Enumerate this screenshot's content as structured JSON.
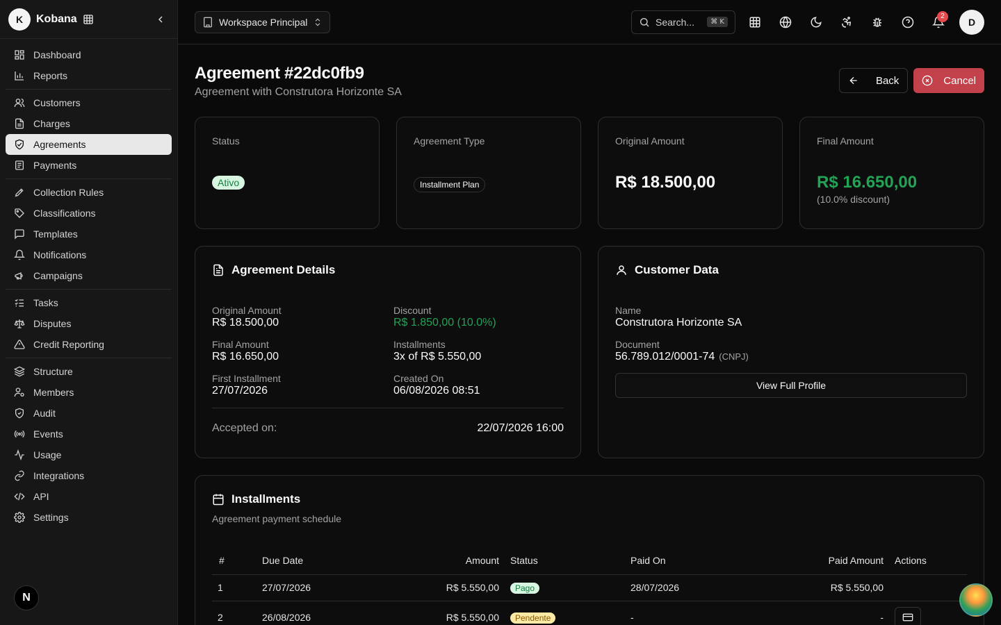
{
  "brand": {
    "initial": "K",
    "name": "Kobana"
  },
  "sidebar": {
    "groups": [
      [
        {
          "label": "Dashboard",
          "icon": "dashboard-icon"
        },
        {
          "label": "Reports",
          "icon": "chart-bar-icon"
        }
      ],
      [
        {
          "label": "Customers",
          "icon": "users-icon"
        },
        {
          "label": "Charges",
          "icon": "receipt-icon"
        },
        {
          "label": "Agreements",
          "icon": "handshake-icon",
          "active": true
        },
        {
          "label": "Payments",
          "icon": "wallet-icon"
        }
      ],
      [
        {
          "label": "Collection Rules",
          "icon": "pencil-ruler-icon"
        },
        {
          "label": "Classifications",
          "icon": "tags-icon"
        },
        {
          "label": "Templates",
          "icon": "message-square-icon"
        },
        {
          "label": "Notifications",
          "icon": "bell-icon"
        },
        {
          "label": "Campaigns",
          "icon": "megaphone-icon"
        }
      ],
      [
        {
          "label": "Tasks",
          "icon": "list-checks-icon"
        },
        {
          "label": "Disputes",
          "icon": "scale-icon"
        },
        {
          "label": "Credit Reporting",
          "icon": "alert-triangle-icon"
        }
      ],
      [
        {
          "label": "Structure",
          "icon": "layers-icon"
        },
        {
          "label": "Members",
          "icon": "user-cog-icon"
        },
        {
          "label": "Audit",
          "icon": "shield-check-icon"
        },
        {
          "label": "Events",
          "icon": "radio-icon"
        },
        {
          "label": "Usage",
          "icon": "activity-icon"
        },
        {
          "label": "Integrations",
          "icon": "link-icon"
        },
        {
          "label": "API",
          "icon": "code-icon"
        },
        {
          "label": "Settings",
          "icon": "settings-icon"
        }
      ]
    ],
    "footer_badge": "N"
  },
  "topbar": {
    "workspace": "Workspace Principal",
    "search_placeholder": "Search...",
    "search_shortcut": "⌘ K",
    "notification_count": "2",
    "user_initial": "D"
  },
  "page": {
    "title": "Agreement #22dc0fb9",
    "subtitle": "Agreement with Construtora Horizonte SA",
    "back_label": "Back",
    "cancel_label": "Cancel"
  },
  "stats": {
    "status_label": "Status",
    "status_value": "Ativo",
    "type_label": "Agreement Type",
    "type_value": "Installment Plan",
    "original_label": "Original Amount",
    "original_value": "R$ 18.500,00",
    "final_label": "Final Amount",
    "final_value": "R$ 16.650,00",
    "final_note": "(10.0% discount)"
  },
  "details": {
    "title": "Agreement Details",
    "original_label": "Original Amount",
    "original_value": "R$ 18.500,00",
    "discount_label": "Discount",
    "discount_value": "R$ 1.850,00 (10.0%)",
    "final_label": "Final Amount",
    "final_value": "R$ 16.650,00",
    "installments_label": "Installments",
    "installments_value": "3x of R$ 5.550,00",
    "first_label": "First Installment",
    "first_value": "27/07/2026",
    "created_label": "Created On",
    "created_value": "06/08/2026 08:51",
    "accepted_label": "Accepted on:",
    "accepted_value": "22/07/2026 16:00"
  },
  "customer": {
    "title": "Customer Data",
    "name_label": "Name",
    "name_value": "Construtora Horizonte SA",
    "doc_label": "Document",
    "doc_value": "56.789.012/0001-74",
    "doc_type": "(CNPJ)",
    "profile_button": "View Full Profile"
  },
  "installments": {
    "title": "Installments",
    "subtitle": "Agreement payment schedule",
    "columns": {
      "num": "#",
      "due": "Due Date",
      "amount": "Amount",
      "status": "Status",
      "paid_on": "Paid On",
      "paid_amount": "Paid Amount",
      "actions": "Actions"
    },
    "rows": [
      {
        "num": "1",
        "due": "27/07/2026",
        "amount": "R$ 5.550,00",
        "status": "Pago",
        "paid_on": "28/07/2026",
        "paid_amount": "R$ 5.550,00"
      },
      {
        "num": "2",
        "due": "26/08/2026",
        "amount": "R$ 5.550,00",
        "status": "Pendente",
        "paid_on": "-",
        "paid_amount": "-"
      }
    ]
  }
}
